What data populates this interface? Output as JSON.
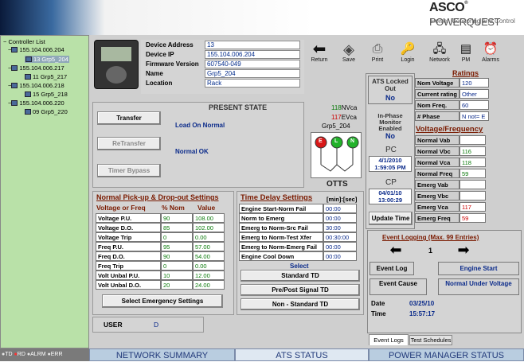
{
  "brand": {
    "logo": "ASCO",
    "product": "POWERQUEST",
    "tagline": "Power Monitoring and Control"
  },
  "tree": {
    "root": "Controller List",
    "items": [
      {
        "label": "155.104.006.204",
        "child": "13 Grp5_204",
        "selected": true
      },
      {
        "label": "155.104.006.217",
        "child": "11 Grp5_217"
      },
      {
        "label": "155.104.006.218",
        "child": "15 Grp5_218"
      },
      {
        "label": "155.104.006.220",
        "child": "09 Grp5_220"
      }
    ]
  },
  "device": {
    "address_label": "Device Address",
    "address": "13",
    "ip_label": "Device IP",
    "ip": "155.104.006.204",
    "fw_label": "Firmware Version",
    "fw": "607540-049",
    "name_label": "Name",
    "name": "Grp5_204",
    "loc_label": "Location",
    "loc": "Rack"
  },
  "toolbar": {
    "return": "Return",
    "save": "Save",
    "print": "Print",
    "login": "Login",
    "network": "Network",
    "pm": "PM",
    "alarms": "Alarms"
  },
  "present": {
    "title": "PRESENT STATE",
    "state1": "Load On Normal",
    "state2": "Normal OK",
    "transfer": "Transfer",
    "retransfer": "ReTransfer",
    "timer_bypass": "Timer Bypass"
  },
  "otts": {
    "nvca": "118",
    "nvca_unit": "NVca",
    "evca": "117",
    "evca_unit": "EVca",
    "grp": "Grp5_204",
    "label": "OTTS",
    "e": "E",
    "l": "L",
    "n": "N"
  },
  "ats": {
    "locked_title": "ATS Locked Out",
    "locked_val": "No",
    "inphase_title": "In-Phase Monitor Enabled",
    "inphase_val": "No",
    "pc": "PC",
    "pc_time": "4/1/2010 1:59:05 PM",
    "cp": "CP",
    "cp_time": "04/01/10 13:00:29",
    "update_time": "Update Time"
  },
  "ratings": {
    "title": "Ratings",
    "rows": [
      {
        "label": "Nom Voltage",
        "value": "120"
      },
      {
        "label": "Current rating",
        "value": "Other"
      },
      {
        "label": "Nom Freq.",
        "value": "60"
      },
      {
        "label": "# Phase",
        "value": "N not= E"
      }
    ]
  },
  "vf": {
    "title": "Voltage/Frequency",
    "rows": [
      {
        "label": "Normal Vab",
        "value": ""
      },
      {
        "label": "Normal Vbc",
        "value": "116"
      },
      {
        "label": "Normal Vca",
        "value": "118"
      },
      {
        "label": "Normal Freq",
        "value": "59"
      },
      {
        "label": "Emerg Vab",
        "value": ""
      },
      {
        "label": "Emerg Vbc",
        "value": ""
      },
      {
        "label": "Emerg Vca",
        "value": "117",
        "red": true
      },
      {
        "label": "Emerg Freq",
        "value": "59",
        "red": true
      }
    ]
  },
  "npd": {
    "title": "Normal Pick-up & Drop-out Settings",
    "h1": "Voltage or Freq",
    "h2": "% Nom",
    "h3": "Value",
    "rows": [
      {
        "n": "Voltage P.U.",
        "p": "90",
        "v": "108.00"
      },
      {
        "n": "Voltage D.O.",
        "p": "85",
        "v": "102.00"
      },
      {
        "n": "Voltage Trip",
        "p": "0",
        "v": "0.00"
      },
      {
        "n": "Freq P.U.",
        "p": "95",
        "v": "57.00"
      },
      {
        "n": "Freq D.O.",
        "p": "90",
        "v": "54.00"
      },
      {
        "n": "Freq Trip",
        "p": "0",
        "v": "0.00"
      },
      {
        "n": "Volt Unbal P.U.",
        "p": "10",
        "v": "12.00"
      },
      {
        "n": "Volt Unbal D.O.",
        "p": "20",
        "v": "24.00"
      }
    ],
    "select_btn": "Select Emergency Settings"
  },
  "td": {
    "title": "Time Delay Settings",
    "unit": "[min]:[sec]",
    "rows": [
      {
        "n": "Engine Start-Norm Fail",
        "v": "00:00"
      },
      {
        "n": "Norm to Emerg",
        "v": "00:00"
      },
      {
        "n": "Emerg to Norm-Src Fail",
        "v": "30:00"
      },
      {
        "n": "Emerg to Norm-Test Xfer",
        "v": "00:30:00"
      },
      {
        "n": "Emerg to Norm-Emerg Fail",
        "v": "00:00"
      },
      {
        "n": "Engine Cool Down",
        "v": "00:00"
      }
    ],
    "select": "Select",
    "b1": "Standard TD",
    "b2": "Pre/Post Signal TD",
    "b3": "Non - Standard TD"
  },
  "user": {
    "label": "USER",
    "value": "D"
  },
  "evlog": {
    "title": "Event Logging (Max. 99 Entries)",
    "index": "1",
    "event_log": "Event Log",
    "event_log_val": "Engine Start",
    "cause": "Event Cause",
    "cause_val": "Normal Under Voltage",
    "date_label": "Date",
    "date": "03/25/10",
    "time_label": "Time",
    "time": "15:57:17",
    "tab1": "Event Logs",
    "tab2": "Test Schedules"
  },
  "status": {
    "td": "TD",
    "rd": "RD",
    "alrm": "ALRM",
    "err": "ERR"
  },
  "bottom": {
    "t1": "NETWORK SUMMARY",
    "t2": "ATS STATUS",
    "t3": "POWER MANAGER STATUS"
  }
}
